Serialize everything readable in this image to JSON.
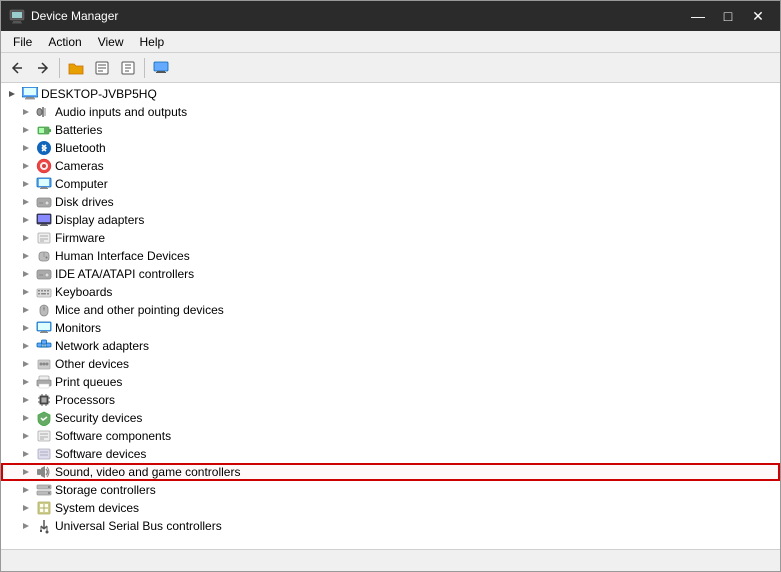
{
  "window": {
    "title": "Device Manager",
    "title_icon": "🖥"
  },
  "menu": {
    "items": [
      "File",
      "Action",
      "View",
      "Help"
    ]
  },
  "toolbar": {
    "buttons": [
      "←",
      "→",
      "📁",
      "🔒",
      "📋",
      "🖥"
    ]
  },
  "tree": {
    "root_label": "DESKTOP-JVBP5HQ",
    "items": [
      {
        "label": "Audio inputs and outputs",
        "icon": "audio",
        "indent": 2
      },
      {
        "label": "Batteries",
        "icon": "battery",
        "indent": 2
      },
      {
        "label": "Bluetooth",
        "icon": "bluetooth",
        "indent": 2
      },
      {
        "label": "Cameras",
        "icon": "camera",
        "indent": 2
      },
      {
        "label": "Computer",
        "icon": "computer",
        "indent": 2
      },
      {
        "label": "Disk drives",
        "icon": "disk",
        "indent": 2
      },
      {
        "label": "Display adapters",
        "icon": "display",
        "indent": 2
      },
      {
        "label": "Firmware",
        "icon": "firmware",
        "indent": 2
      },
      {
        "label": "Human Interface Devices",
        "icon": "hid",
        "indent": 2
      },
      {
        "label": "IDE ATA/ATAPI controllers",
        "icon": "ide",
        "indent": 2
      },
      {
        "label": "Keyboards",
        "icon": "keyboard",
        "indent": 2
      },
      {
        "label": "Mice and other pointing devices",
        "icon": "mouse",
        "indent": 2
      },
      {
        "label": "Monitors",
        "icon": "monitor",
        "indent": 2
      },
      {
        "label": "Network adapters",
        "icon": "network",
        "indent": 2
      },
      {
        "label": "Other devices",
        "icon": "other",
        "indent": 2
      },
      {
        "label": "Print queues",
        "icon": "print",
        "indent": 2
      },
      {
        "label": "Processors",
        "icon": "processor",
        "indent": 2
      },
      {
        "label": "Security devices",
        "icon": "security",
        "indent": 2
      },
      {
        "label": "Software components",
        "icon": "software_comp",
        "indent": 2
      },
      {
        "label": "Software devices",
        "icon": "software_dev",
        "indent": 2
      },
      {
        "label": "Sound, video and game controllers",
        "icon": "sound",
        "indent": 2,
        "highlighted": true
      },
      {
        "label": "Storage controllers",
        "icon": "storage",
        "indent": 2
      },
      {
        "label": "System devices",
        "icon": "system",
        "indent": 2
      },
      {
        "label": "Universal Serial Bus controllers",
        "icon": "usb",
        "indent": 2
      }
    ]
  },
  "status_bar": {
    "text": ""
  }
}
